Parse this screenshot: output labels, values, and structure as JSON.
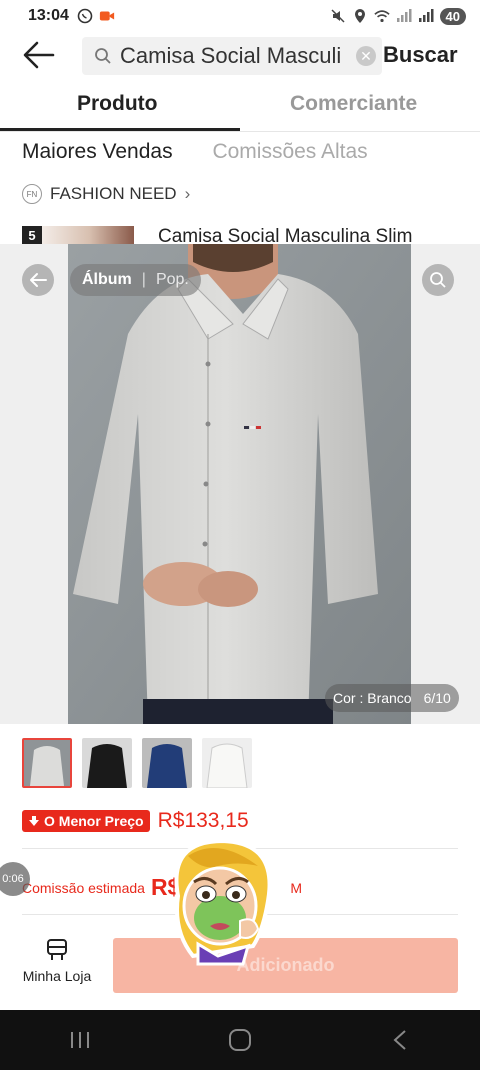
{
  "status_bar": {
    "time": "13:04",
    "battery": "40"
  },
  "search": {
    "query": "Camisa Social Masculi",
    "submit_label": "Buscar"
  },
  "tabs": [
    {
      "label": "Produto",
      "active": true
    },
    {
      "label": "Comerciante",
      "active": false
    }
  ],
  "sort": {
    "options": [
      "Maiores Vendas",
      "Comissões Altas"
    ]
  },
  "shop": {
    "name": "FASHION NEED",
    "logo_text": "FN"
  },
  "product": {
    "rank": "5",
    "title": "Camisa Social Masculina Slim"
  },
  "gallery": {
    "tab_album": "Álbum",
    "tab_pop": "Pop.",
    "color_label": "Cor : Branco",
    "counter": "6/10"
  },
  "price": {
    "badge": "O Menor Preço",
    "value": "R$133,15"
  },
  "commission": {
    "label": "Comissão estimada",
    "value_visible": "R$",
    "suffix": "M"
  },
  "bottom": {
    "store_label": "Minha Loja",
    "add_label": "Adicionado"
  },
  "timer": "0:06",
  "colors": {
    "accent_red": "#e8291c",
    "button_disabled": "#f7b5a3"
  }
}
